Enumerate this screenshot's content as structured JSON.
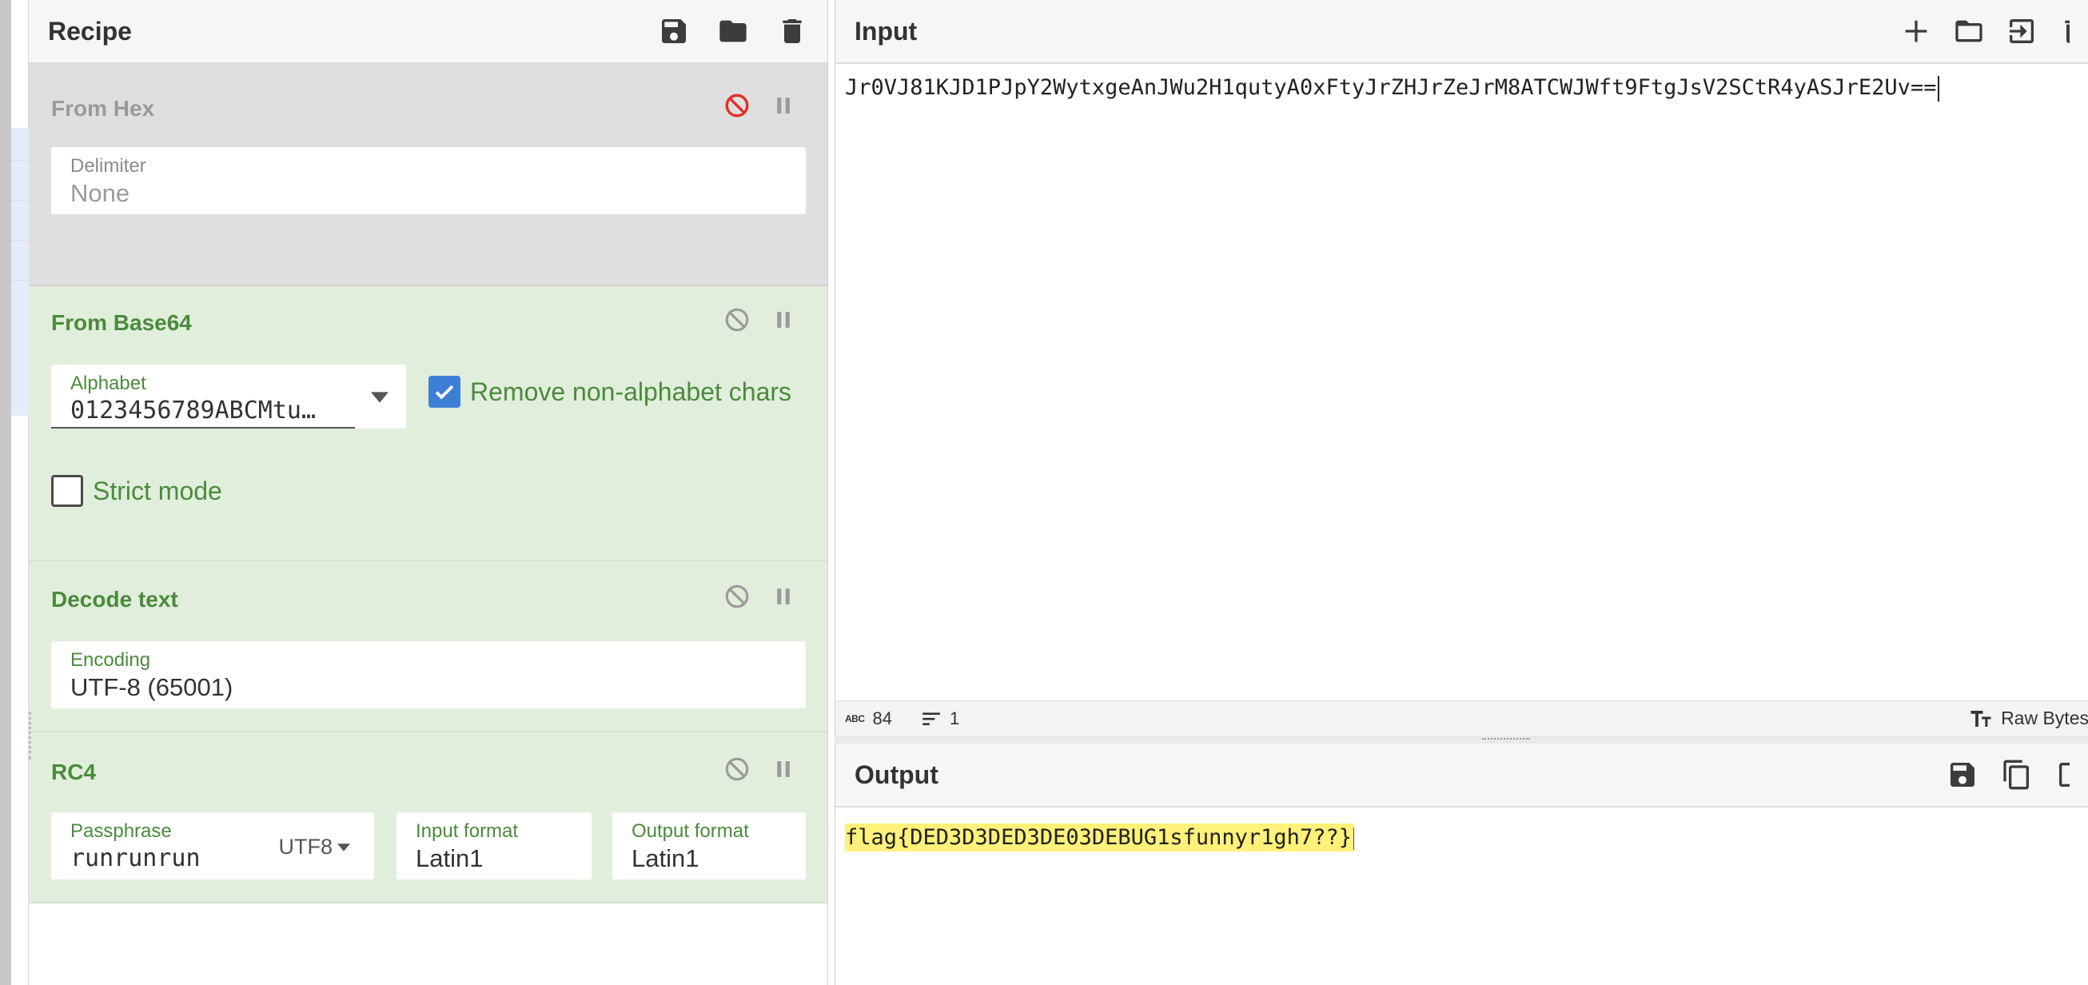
{
  "recipe": {
    "title": "Recipe",
    "operations": [
      {
        "name": "From Hex",
        "state": "disabled",
        "fields": [
          {
            "label": "Delimiter",
            "value": "None"
          }
        ]
      },
      {
        "name": "From Base64",
        "state": "active",
        "fields": [
          {
            "label": "Alphabet",
            "value": "0123456789ABCMtu…"
          }
        ],
        "checkboxes": [
          {
            "label": "Remove non-alphabet chars",
            "checked": true
          },
          {
            "label": "Strict mode",
            "checked": false
          }
        ]
      },
      {
        "name": "Decode text",
        "state": "active",
        "fields": [
          {
            "label": "Encoding",
            "value": "UTF-8 (65001)"
          }
        ]
      },
      {
        "name": "RC4",
        "state": "active",
        "fields": [
          {
            "label": "Passphrase",
            "value": "runrunrun",
            "format": "UTF8"
          },
          {
            "label": "Input format",
            "value": "Latin1"
          },
          {
            "label": "Output format",
            "value": "Latin1"
          }
        ]
      }
    ]
  },
  "input": {
    "title": "Input",
    "text": "Jr0VJ81KJD1PJpY2WytxgeAnJWu2H1qutyA0xFtyJrZHJrZeJrM8ATCWJWft9FtgJsV2SCtR4yASJrE2Uv==",
    "status": {
      "length_icon_label": "ABC",
      "length": "84",
      "lines": "1",
      "mode": "Raw Bytes"
    }
  },
  "output": {
    "title": "Output",
    "text": "flag{DED3D3DED3DE03DEBUG1sfunnyr1gh7??}"
  },
  "colors": {
    "active_op_bg": "#e1eedb",
    "disabled_op_bg": "#dfdfdf",
    "op_title_active": "#4b8a3d",
    "disable_icon_red": "#e0312b",
    "checkbox_blue": "#3e7fd6",
    "output_highlight": "#fff17a"
  },
  "icons": {
    "recipe_header": [
      "save-icon",
      "folder-icon",
      "trash-icon"
    ],
    "input_header": [
      "plus-icon",
      "folder-icon",
      "import-icon",
      "trash-icon"
    ],
    "output_header": [
      "save-icon",
      "copy-icon",
      "export-icon"
    ],
    "op_controls": [
      "disable-icon",
      "pause-icon"
    ]
  }
}
